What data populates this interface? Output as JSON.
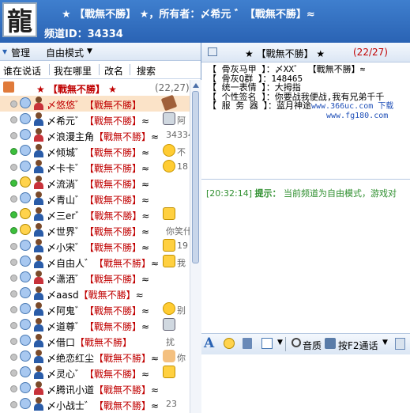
{
  "header": {
    "logo_char": "龍",
    "title": "★ 【戰無不勝】 ★，所有者：〆希元 ゛【戰無不勝】≈",
    "channel_label": "频道ID：34334"
  },
  "left_toolbar": {
    "manage": "管理",
    "mode": "自由模式"
  },
  "tabs": [
    "谁在说话",
    "我在哪里",
    "改名",
    "搜索"
  ],
  "group": {
    "name": "★ 【戰無不勝】 ★",
    "count": "(22,27)"
  },
  "members": [
    {
      "prefix": "〆悠悠゛",
      "clan": "【戰無不勝】",
      "suffix": "",
      "extra": "",
      "emoji": "tag"
    },
    {
      "prefix": "〆希元゛",
      "clan": "【戰無不勝】",
      "suffix": "≈",
      "extra": "阿",
      "emoji": "cube"
    },
    {
      "prefix": "〆浪漫主角",
      "clan": "【戰無不勝】",
      "suffix": "≈",
      "extra": "34334",
      "emoji": ""
    },
    {
      "prefix": "〆倾城゛",
      "clan": "【戰無不勝】",
      "suffix": "≈",
      "extra": "不",
      "emoji": "smile"
    },
    {
      "prefix": "〆卡卡゛",
      "clan": "【戰無不勝】",
      "suffix": "≈",
      "extra": "18",
      "emoji": "smile"
    },
    {
      "prefix": "〆流淌゛",
      "clan": "【戰無不勝】",
      "suffix": "≈",
      "extra": "",
      "emoji": ""
    },
    {
      "prefix": "〆青山゛",
      "clan": "【戰無不勝】",
      "suffix": "≈",
      "extra": "",
      "emoji": ""
    },
    {
      "prefix": "〆三er゛",
      "clan": "【戰無不勝】",
      "suffix": "≈",
      "extra": "",
      "emoji": "sq"
    },
    {
      "prefix": "〆世界゛",
      "clan": "【戰無不勝】",
      "suffix": "≈",
      "extra": "你笑什",
      "emoji": ""
    },
    {
      "prefix": "〆小宋゛",
      "clan": "【戰無不勝】",
      "suffix": "≈",
      "extra": "19",
      "emoji": "sq"
    },
    {
      "prefix": "〆自由人゛",
      "clan": "【戰無不勝】",
      "suffix": "≈",
      "extra": "我",
      "emoji": "sq"
    },
    {
      "prefix": "〆潇洒゛",
      "clan": "【戰無不勝】",
      "suffix": "≈",
      "extra": "",
      "emoji": ""
    },
    {
      "prefix": "〆aasd",
      "clan": "【戰無不勝】",
      "suffix": "≈",
      "extra": "",
      "emoji": ""
    },
    {
      "prefix": "〆阿鬼゛",
      "clan": "【戰無不勝】",
      "suffix": "≈",
      "extra": "别",
      "emoji": "smile"
    },
    {
      "prefix": "〆道尊゛",
      "clan": "【戰無不勝】",
      "suffix": "≈",
      "extra": "",
      "emoji": "cube"
    },
    {
      "prefix": "〆借口",
      "clan": "【戰無不勝】",
      "suffix": "",
      "extra": "扰",
      "emoji": ""
    },
    {
      "prefix": "〆绝恋红尘",
      "clan": "【戰無不勝】",
      "suffix": "≈",
      "extra": "你",
      "emoji": "thumb"
    },
    {
      "prefix": "〆灵心゛",
      "clan": "【戰無不勝】",
      "suffix": "≈",
      "extra": "",
      "emoji": "sq"
    },
    {
      "prefix": "〆腾讯小道",
      "clan": "【戰無不勝】",
      "suffix": "≈",
      "extra": "",
      "emoji": ""
    },
    {
      "prefix": "〆小战士゛",
      "clan": "【戰無不勝】",
      "suffix": "≈",
      "extra": "23",
      "emoji": ""
    }
  ],
  "channel": {
    "title": "★ 【戰無不勝】 ★",
    "count": "(22/27)"
  },
  "info_lines": [
    {
      "label": "【  骨灰马甲  】",
      "value": "：〆XX゛  【戰無不勝】≈"
    },
    {
      "label": "【  骨灰Q群  】",
      "value": "：148465"
    },
    {
      "label": "【  统一表情  】",
      "value": "：大拇指"
    },
    {
      "label": "【  个性签名  】",
      "value": "：你要战我便战,我有兄弟千千"
    },
    {
      "label": "【  服 务 器  】",
      "value": "：蓝月神途"
    }
  ],
  "links": [
    "www.366uc.com 下载",
    "www.fg180.com"
  ],
  "system_msg": {
    "time": "[20:32:14]",
    "label": "提示：",
    "text": "当前频道为自由模式，游戏对"
  },
  "toolbar": {
    "sound": "音质",
    "ptt": "按F2通话"
  }
}
